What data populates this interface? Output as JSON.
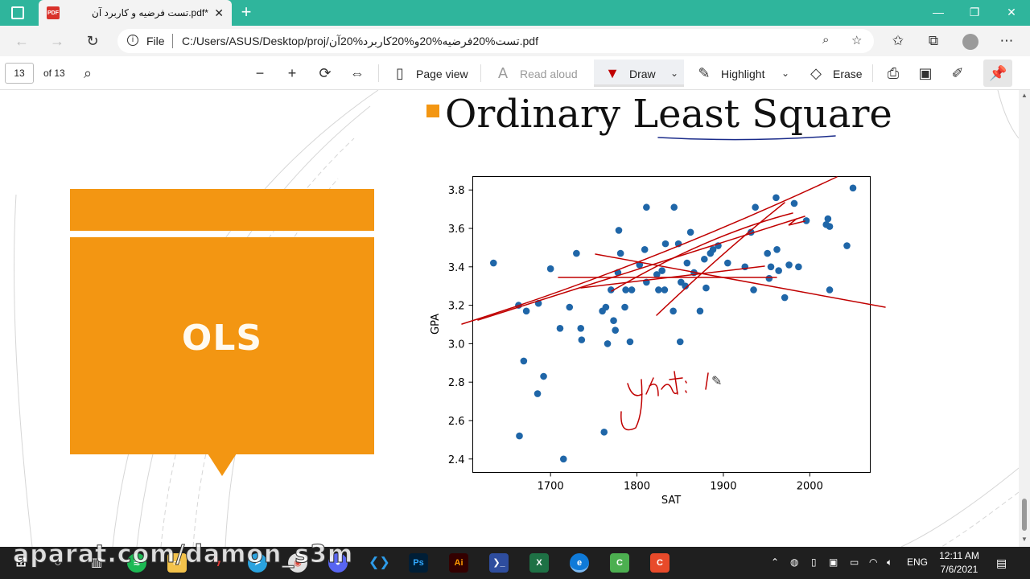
{
  "browser": {
    "tab_title": "تست فرضیه و کاربرد آن.pdf*",
    "close_glyph": "✕",
    "newtab_glyph": "+",
    "window": {
      "minimize": "—",
      "restore": "❐",
      "close": "✕"
    },
    "address": {
      "file_label": "File",
      "url": "C:/Users/ASUS/Desktop/proj/تست%20فرضیه%20و%20کاربرد%20آن.pdf"
    }
  },
  "pdf_toolbar": {
    "page_current": "13",
    "page_total": "of 13",
    "zoom_out": "−",
    "zoom_in": "+",
    "page_view": "Page view",
    "read_aloud": "Read aloud",
    "draw": "Draw",
    "highlight": "Highlight",
    "erase": "Erase"
  },
  "slide": {
    "title": "Ordinary Least Square",
    "box_label": "OLS",
    "accent_color": "#f39612"
  },
  "chart_data": {
    "type": "scatter",
    "xlabel": "SAT",
    "ylabel": "GPA",
    "xlim": [
      1610,
      2070
    ],
    "ylim": [
      2.33,
      3.87
    ],
    "xticks": [
      1700,
      1800,
      1900,
      2000
    ],
    "yticks": [
      2.4,
      2.6,
      2.8,
      3.0,
      3.2,
      3.4,
      3.6,
      3.8
    ],
    "xtick_labels": [
      "1700",
      "1800",
      "1900",
      "2000"
    ],
    "ytick_labels": [
      "2.4",
      "2.6",
      "2.8",
      "3.0",
      "3.2",
      "3.4",
      "3.6",
      "3.8"
    ],
    "grid": false,
    "point_color": "#1f66a8",
    "points": [
      [
        1634,
        3.42
      ],
      [
        1663,
        3.2
      ],
      [
        1664,
        2.52
      ],
      [
        1669,
        2.91
      ],
      [
        1672,
        3.17
      ],
      [
        1685,
        2.74
      ],
      [
        1686,
        3.21
      ],
      [
        1692,
        2.83
      ],
      [
        1700,
        3.39
      ],
      [
        1711,
        3.08
      ],
      [
        1715,
        2.4
      ],
      [
        1722,
        3.19
      ],
      [
        1730,
        3.47
      ],
      [
        1735,
        3.08
      ],
      [
        1736,
        3.02
      ],
      [
        1760,
        3.17
      ],
      [
        1762,
        2.54
      ],
      [
        1764,
        3.19
      ],
      [
        1766,
        3.0
      ],
      [
        1770,
        3.28
      ],
      [
        1773,
        3.12
      ],
      [
        1775,
        3.07
      ],
      [
        1778,
        3.37
      ],
      [
        1779,
        3.59
      ],
      [
        1781,
        3.47
      ],
      [
        1786,
        3.19
      ],
      [
        1787,
        3.28
      ],
      [
        1792,
        3.01
      ],
      [
        1794,
        3.28
      ],
      [
        1803,
        3.41
      ],
      [
        1809,
        3.49
      ],
      [
        1811,
        3.32
      ],
      [
        1811,
        3.71
      ],
      [
        1823,
        3.36
      ],
      [
        1825,
        3.28
      ],
      [
        1829,
        3.38
      ],
      [
        1832,
        3.28
      ],
      [
        1833,
        3.52
      ],
      [
        1842,
        3.17
      ],
      [
        1843,
        3.71
      ],
      [
        1848,
        3.52
      ],
      [
        1850,
        3.01
      ],
      [
        1851,
        3.32
      ],
      [
        1856,
        3.3
      ],
      [
        1858,
        3.42
      ],
      [
        1862,
        3.58
      ],
      [
        1866,
        3.37
      ],
      [
        1873,
        3.17
      ],
      [
        1878,
        3.44
      ],
      [
        1880,
        3.29
      ],
      [
        1885,
        3.47
      ],
      [
        1888,
        3.49
      ],
      [
        1894,
        3.51
      ],
      [
        1905,
        3.42
      ],
      [
        1925,
        3.4
      ],
      [
        1932,
        3.58
      ],
      [
        1935,
        3.28
      ],
      [
        1937,
        3.71
      ],
      [
        1951,
        3.47
      ],
      [
        1953,
        3.34
      ],
      [
        1955,
        3.4
      ],
      [
        1961,
        3.76
      ],
      [
        1962,
        3.49
      ],
      [
        1964,
        3.38
      ],
      [
        1971,
        3.24
      ],
      [
        1976,
        3.41
      ],
      [
        1982,
        3.73
      ],
      [
        1987,
        3.4
      ],
      [
        1996,
        3.64
      ],
      [
        2019,
        3.62
      ],
      [
        2021,
        3.65
      ],
      [
        2023,
        3.61
      ],
      [
        2023,
        3.28
      ],
      [
        2043,
        3.51
      ],
      [
        2050,
        3.81
      ]
    ]
  },
  "taskbar": {
    "language": "ENG",
    "time": "12:11 AM",
    "date": "7/6/2021",
    "apps": [
      "Ps",
      "Ai"
    ],
    "watermark": "aparat.com/damon_s3m"
  }
}
